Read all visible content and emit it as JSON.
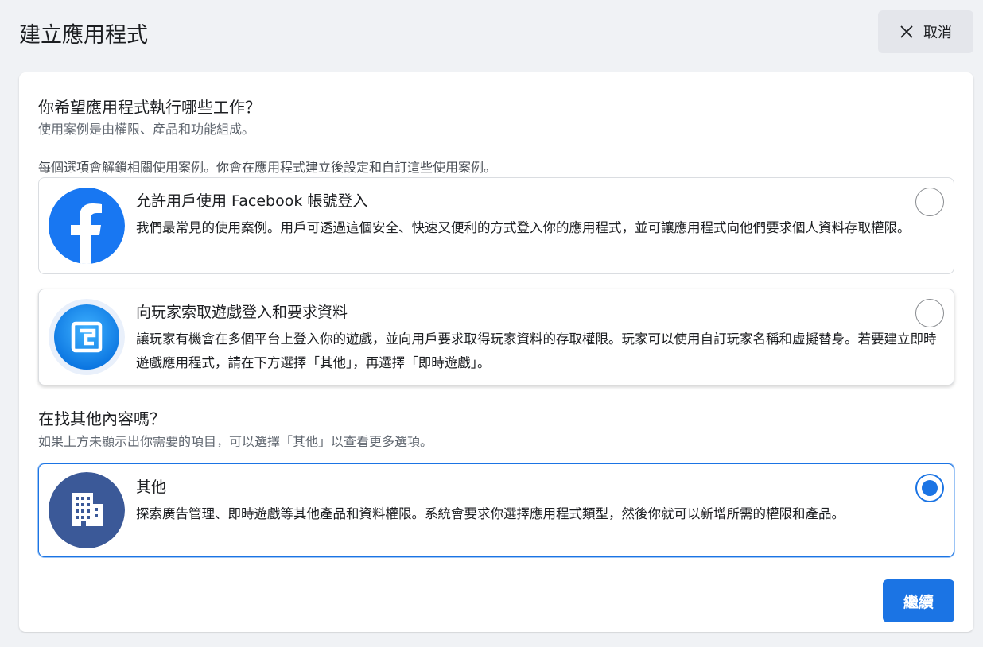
{
  "header": {
    "title": "建立應用程式",
    "cancel_label": "取消"
  },
  "main": {
    "question_title": "你希望應用程式執行哪些工作？",
    "question_subtitle": "使用案例是由權限、產品和功能組成。",
    "note": "每個選項會解鎖相關使用案例。你會在應用程式建立後設定和自訂這些使用案例。",
    "options": [
      {
        "title": "允許用戶使用 Facebook 帳號登入",
        "description": "我們最常見的使用案例。用戶可透過這個安全、快速又便利的方式登入你的應用程式，並可讓應用程式向他們要求個人資料存取權限。",
        "icon": "facebook-logo-icon",
        "selected": false
      },
      {
        "title": "向玩家索取遊戲登入和要求資料",
        "description": "讓玩家有機會在多個平台上登入你的遊戲，並向用戶要求取得玩家資料的存取權限。玩家可以使用自訂玩家名稱和虛擬替身。若要建立即時遊戲應用程式，請在下方選擇「其他」，再選擇「即時遊戲」。",
        "icon": "gaming-icon",
        "selected": false
      }
    ],
    "other_section_title": "在找其他內容嗎？",
    "other_section_subtitle": "如果上方未顯示出你需要的項目，可以選擇「其他」以查看更多選項。",
    "other_option": {
      "title": "其他",
      "description": "探索廣告管理、即時遊戲等其他產品和資料權限。系統會要求你選擇應用程式類型，然後你就可以新增所需的權限和產品。",
      "icon": "building-icon",
      "selected": true
    },
    "continue_label": "繼續"
  },
  "colors": {
    "accent": "#1b74e4",
    "background": "#f0f2f5",
    "facebook_blue": "#1877f2",
    "other_icon_bg": "#3b5998"
  }
}
